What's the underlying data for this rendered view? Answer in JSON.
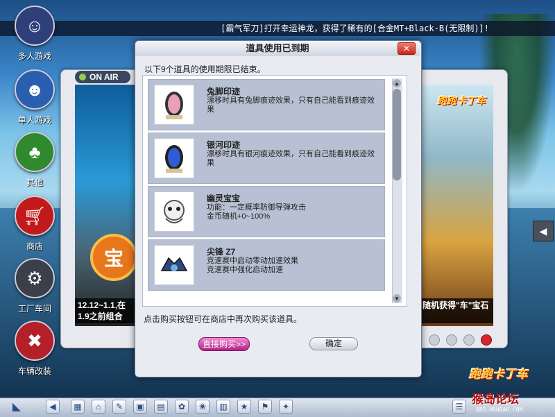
{
  "marquee": "[霸气军刀]打开幸运神龙，获得了稀有的[合金MT+Black-B(无限制)]!",
  "nav": [
    {
      "label": "多人游戏",
      "icon": "multiplayer-icon",
      "color": "#2f3f7a"
    },
    {
      "label": "单人游戏",
      "icon": "singleplayer-icon",
      "color": "#2a5fb0"
    },
    {
      "label": "其他",
      "icon": "other-icon",
      "color": "#2f8a2f"
    },
    {
      "label": "商店",
      "icon": "shop-cart-icon",
      "color": "#c21a1a"
    },
    {
      "label": "工厂车间",
      "icon": "factory-icon",
      "color": "#3a3f4a"
    },
    {
      "label": "车辆改装",
      "icon": "tools-icon",
      "color": "#b3202a"
    }
  ],
  "background_window": {
    "onair": "ON AIR",
    "promo_left": "12.12~1.1,在1.9之前组合",
    "promo_right": "随机获得\"车\"宝石",
    "brand": "跑跑卡丁车",
    "left_letter": "宝"
  },
  "dialog": {
    "title": "道具使用已到期",
    "close": "✕",
    "description": "以下9个道具的使用期限已结束。",
    "items": [
      {
        "name": "兔脚印迹",
        "desc": "漂移时具有兔脚痕迹效果，只有自己能看到痕迹效果",
        "icon": "pink-tire-icon"
      },
      {
        "name": "银河印迹",
        "desc": "漂移时具有银河痕迹效果，只有自己能看到痕迹效果",
        "icon": "blue-tire-icon"
      },
      {
        "name": "幽灵宝宝",
        "desc": "功能：一定概率防御导弹攻击\n金币随机+0~100%",
        "icon": "ghost-baby-icon"
      },
      {
        "name": "尖锋 Z7",
        "desc": "竞速赛中启动零动加速效果\n竞速赛中强化启动加速",
        "icon": "spike-z7-icon"
      }
    ],
    "footnote": "点击购买按钮可在商店中再次购买该道具。",
    "buy_label": "直接购买>>",
    "ok_label": "确定"
  },
  "brand_bottom": "跑跑卡丁车",
  "watermark": "猴岛论坛",
  "watermark_sub": "BBS.HOUDAO.COM",
  "taskbar_icons": [
    "start-icon",
    "back-icon",
    "shop-icon",
    "home-icon",
    "wrench-icon",
    "card-icon",
    "gift-icon",
    "items-icon",
    "ribbon-icon",
    "book-icon",
    "ranking-icon",
    "flag-icon",
    "star-icon",
    "list-icon",
    "help-icon"
  ]
}
